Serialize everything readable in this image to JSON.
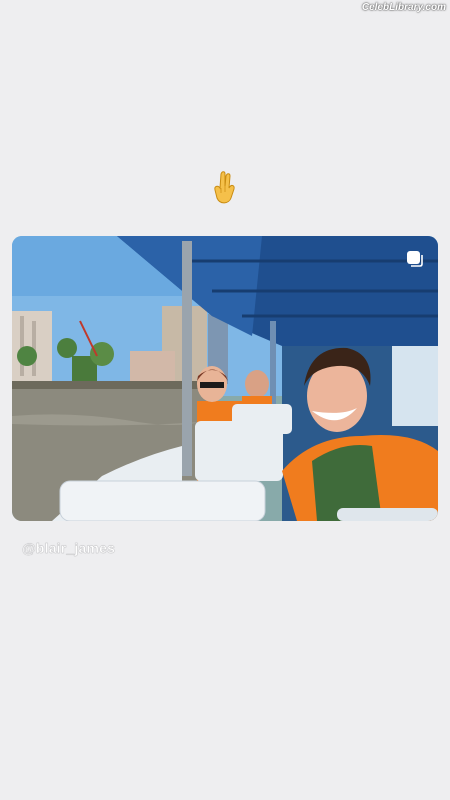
{
  "watermark": "CelebLibrary.com",
  "story": {
    "sticker_emoji": "waving-hand-emoji",
    "post": {
      "icon": "multiple-photos-icon",
      "image_alt": "Group selfie on a river boat wearing orange life vests"
    },
    "username": "@blair_james"
  }
}
